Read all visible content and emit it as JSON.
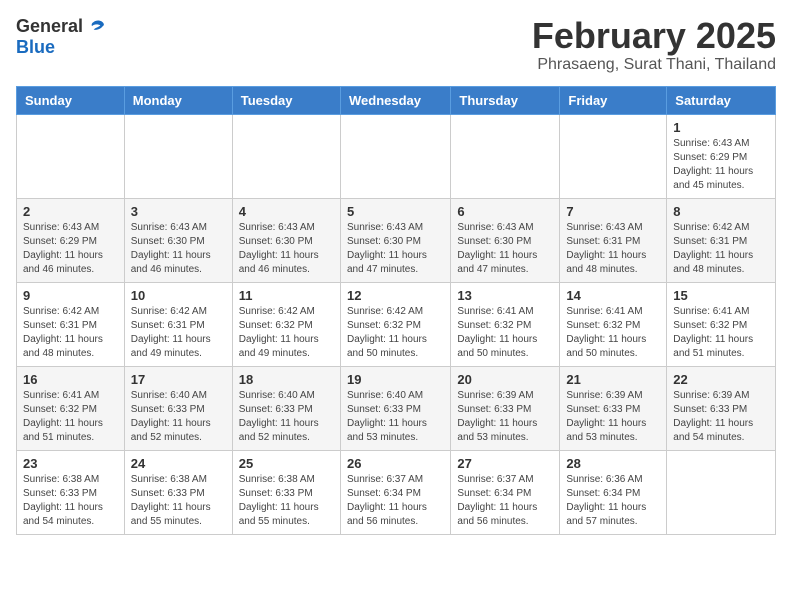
{
  "logo": {
    "general": "General",
    "blue": "Blue"
  },
  "title": {
    "month": "February 2025",
    "location": "Phrasaeng, Surat Thani, Thailand"
  },
  "weekdays": [
    "Sunday",
    "Monday",
    "Tuesday",
    "Wednesday",
    "Thursday",
    "Friday",
    "Saturday"
  ],
  "weeks": [
    [
      {
        "day": "",
        "info": ""
      },
      {
        "day": "",
        "info": ""
      },
      {
        "day": "",
        "info": ""
      },
      {
        "day": "",
        "info": ""
      },
      {
        "day": "",
        "info": ""
      },
      {
        "day": "",
        "info": ""
      },
      {
        "day": "1",
        "info": "Sunrise: 6:43 AM\nSunset: 6:29 PM\nDaylight: 11 hours\nand 45 minutes."
      }
    ],
    [
      {
        "day": "2",
        "info": "Sunrise: 6:43 AM\nSunset: 6:29 PM\nDaylight: 11 hours\nand 46 minutes."
      },
      {
        "day": "3",
        "info": "Sunrise: 6:43 AM\nSunset: 6:30 PM\nDaylight: 11 hours\nand 46 minutes."
      },
      {
        "day": "4",
        "info": "Sunrise: 6:43 AM\nSunset: 6:30 PM\nDaylight: 11 hours\nand 46 minutes."
      },
      {
        "day": "5",
        "info": "Sunrise: 6:43 AM\nSunset: 6:30 PM\nDaylight: 11 hours\nand 47 minutes."
      },
      {
        "day": "6",
        "info": "Sunrise: 6:43 AM\nSunset: 6:30 PM\nDaylight: 11 hours\nand 47 minutes."
      },
      {
        "day": "7",
        "info": "Sunrise: 6:43 AM\nSunset: 6:31 PM\nDaylight: 11 hours\nand 48 minutes."
      },
      {
        "day": "8",
        "info": "Sunrise: 6:42 AM\nSunset: 6:31 PM\nDaylight: 11 hours\nand 48 minutes."
      }
    ],
    [
      {
        "day": "9",
        "info": "Sunrise: 6:42 AM\nSunset: 6:31 PM\nDaylight: 11 hours\nand 48 minutes."
      },
      {
        "day": "10",
        "info": "Sunrise: 6:42 AM\nSunset: 6:31 PM\nDaylight: 11 hours\nand 49 minutes."
      },
      {
        "day": "11",
        "info": "Sunrise: 6:42 AM\nSunset: 6:32 PM\nDaylight: 11 hours\nand 49 minutes."
      },
      {
        "day": "12",
        "info": "Sunrise: 6:42 AM\nSunset: 6:32 PM\nDaylight: 11 hours\nand 50 minutes."
      },
      {
        "day": "13",
        "info": "Sunrise: 6:41 AM\nSunset: 6:32 PM\nDaylight: 11 hours\nand 50 minutes."
      },
      {
        "day": "14",
        "info": "Sunrise: 6:41 AM\nSunset: 6:32 PM\nDaylight: 11 hours\nand 50 minutes."
      },
      {
        "day": "15",
        "info": "Sunrise: 6:41 AM\nSunset: 6:32 PM\nDaylight: 11 hours\nand 51 minutes."
      }
    ],
    [
      {
        "day": "16",
        "info": "Sunrise: 6:41 AM\nSunset: 6:32 PM\nDaylight: 11 hours\nand 51 minutes."
      },
      {
        "day": "17",
        "info": "Sunrise: 6:40 AM\nSunset: 6:33 PM\nDaylight: 11 hours\nand 52 minutes."
      },
      {
        "day": "18",
        "info": "Sunrise: 6:40 AM\nSunset: 6:33 PM\nDaylight: 11 hours\nand 52 minutes."
      },
      {
        "day": "19",
        "info": "Sunrise: 6:40 AM\nSunset: 6:33 PM\nDaylight: 11 hours\nand 53 minutes."
      },
      {
        "day": "20",
        "info": "Sunrise: 6:39 AM\nSunset: 6:33 PM\nDaylight: 11 hours\nand 53 minutes."
      },
      {
        "day": "21",
        "info": "Sunrise: 6:39 AM\nSunset: 6:33 PM\nDaylight: 11 hours\nand 53 minutes."
      },
      {
        "day": "22",
        "info": "Sunrise: 6:39 AM\nSunset: 6:33 PM\nDaylight: 11 hours\nand 54 minutes."
      }
    ],
    [
      {
        "day": "23",
        "info": "Sunrise: 6:38 AM\nSunset: 6:33 PM\nDaylight: 11 hours\nand 54 minutes."
      },
      {
        "day": "24",
        "info": "Sunrise: 6:38 AM\nSunset: 6:33 PM\nDaylight: 11 hours\nand 55 minutes."
      },
      {
        "day": "25",
        "info": "Sunrise: 6:38 AM\nSunset: 6:33 PM\nDaylight: 11 hours\nand 55 minutes."
      },
      {
        "day": "26",
        "info": "Sunrise: 6:37 AM\nSunset: 6:34 PM\nDaylight: 11 hours\nand 56 minutes."
      },
      {
        "day": "27",
        "info": "Sunrise: 6:37 AM\nSunset: 6:34 PM\nDaylight: 11 hours\nand 56 minutes."
      },
      {
        "day": "28",
        "info": "Sunrise: 6:36 AM\nSunset: 6:34 PM\nDaylight: 11 hours\nand 57 minutes."
      },
      {
        "day": "",
        "info": ""
      }
    ]
  ]
}
